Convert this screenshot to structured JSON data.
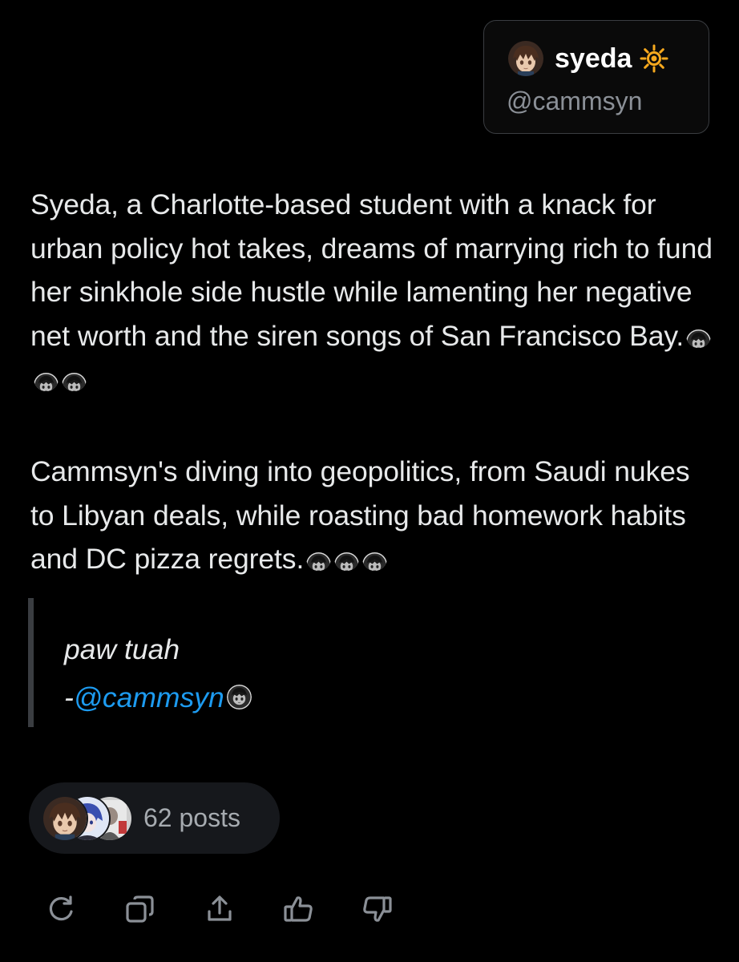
{
  "profile": {
    "display_name": "syeda",
    "handle": "@cammsyn",
    "name_emoji": "sun-icon",
    "avatar": "anime-avatar"
  },
  "summary": {
    "paragraph_1": "Syeda, a Charlotte-based student with a knack for urban policy hot takes, dreams of marrying rich to fund her sinkhole side hustle while lamenting her negative net worth and the siren songs of San Francisco Bay.",
    "paragraph_2": "Cammsyn's diving into geopolitics, from Saudi nukes to Libyan deals, while roasting bad homework habits and DC pizza regrets."
  },
  "quote": {
    "text": "paw tuah",
    "attribution_prefix": "-",
    "attribution_handle": "@cammsyn"
  },
  "posts": {
    "label": "62 posts"
  },
  "actions": [
    {
      "name": "refresh-icon"
    },
    {
      "name": "copy-icon"
    },
    {
      "name": "share-icon"
    },
    {
      "name": "thumbs-up-icon"
    },
    {
      "name": "thumbs-down-icon"
    }
  ],
  "colors": {
    "background": "#000000",
    "text": "#e7e9ea",
    "muted": "#8b9097",
    "link": "#1d9bf0",
    "card_border": "#3a3d41",
    "pill_bg": "#16181c",
    "sun": "#f7a91e"
  }
}
